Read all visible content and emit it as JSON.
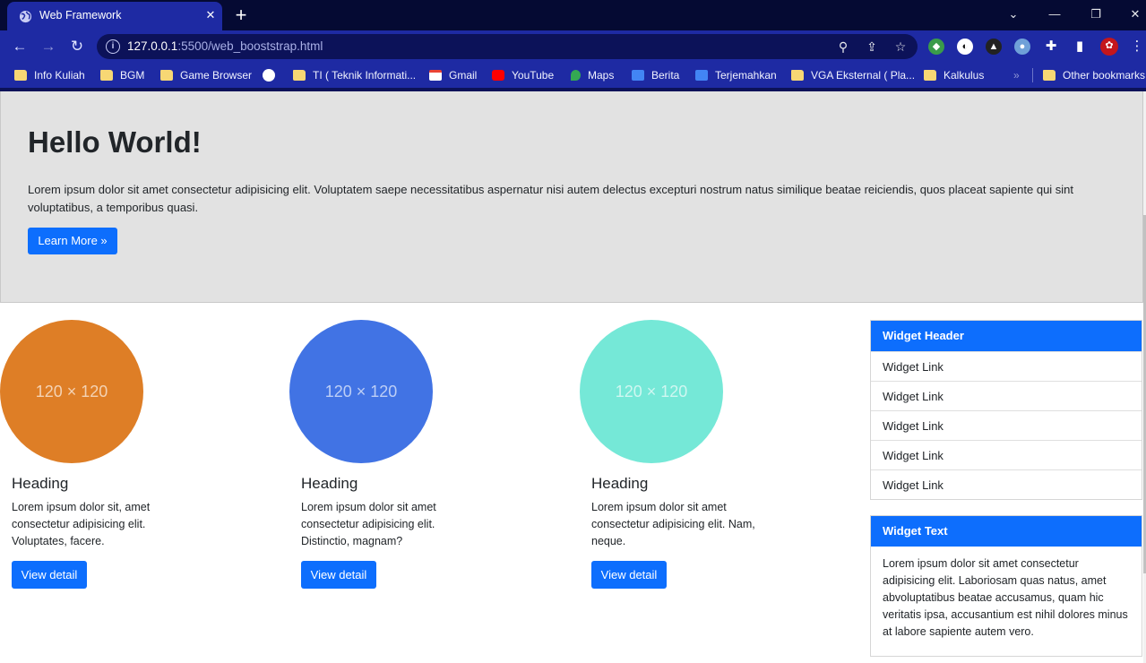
{
  "browser": {
    "tab_title": "Web Framework",
    "url_host": "127.0.0.1",
    "url_rest": ":5500/web_booststrap.html",
    "bookmarks": [
      {
        "label": "Info Kuliah",
        "icon": "folder-icon"
      },
      {
        "label": "BGM",
        "icon": "folder-icon"
      },
      {
        "label": "Game Browser",
        "icon": "folder-icon"
      },
      {
        "label": "",
        "icon": "globe-icon"
      },
      {
        "label": "TI ( Teknik Informati...",
        "icon": "folder-icon"
      },
      {
        "label": "Gmail",
        "icon": "gmail-icon"
      },
      {
        "label": "YouTube",
        "icon": "youtube-icon"
      },
      {
        "label": "Maps",
        "icon": "maps-icon"
      },
      {
        "label": "Berita",
        "icon": "news-icon"
      },
      {
        "label": "Terjemahkan",
        "icon": "translate-icon"
      },
      {
        "label": "VGA Eksternal ( Pla...",
        "icon": "folder-icon"
      },
      {
        "label": "Kalkulus",
        "icon": "folder-icon"
      }
    ],
    "overflow": "»",
    "other_bookmarks": "Other bookmarks"
  },
  "jumbotron": {
    "title": "Hello World!",
    "text": "Lorem ipsum dolor sit amet consectetur adipisicing elit. Voluptatem saepe necessitatibus aspernatur nisi autem delectus excepturi nostrum natus similique beatae reiciendis, quos placeat sapiente qui sint voluptatibus, a temporibus quasi.",
    "button": "Learn More »"
  },
  "cards": [
    {
      "placeholder": "120 × 120",
      "color": "#de7e26",
      "heading": "Heading",
      "text": "Lorem ipsum dolor sit, amet consectetur adipisicing elit. Voluptates, facere.",
      "button": "View detail"
    },
    {
      "placeholder": "120 × 120",
      "color": "#4173e4",
      "heading": "Heading",
      "text": "Lorem ipsum dolor sit amet consectetur adipisicing elit. Distinctio, magnam?",
      "button": "View detail"
    },
    {
      "placeholder": "120 × 120",
      "color": "#75e8d7",
      "heading": "Heading",
      "text": "Lorem ipsum dolor sit amet consectetur adipisicing elit. Nam, neque.",
      "button": "View detail"
    }
  ],
  "widget_links": {
    "header": "Widget Header",
    "links": [
      "Widget Link",
      "Widget Link",
      "Widget Link",
      "Widget Link",
      "Widget Link"
    ]
  },
  "widget_text": {
    "header": "Widget Text",
    "body": "Lorem ipsum dolor sit amet consectetur adipisicing elit. Laboriosam quas natus, amet abvoluptatibus beatae accusamus, quam hic veritatis ipsa, accusantium est nihil dolores minus at labore sapiente autem vero."
  },
  "colors": {
    "primary": "#0d6efd",
    "jumbotron_bg": "#e2e2e2",
    "chrome_bg": "#1e2aa3"
  }
}
